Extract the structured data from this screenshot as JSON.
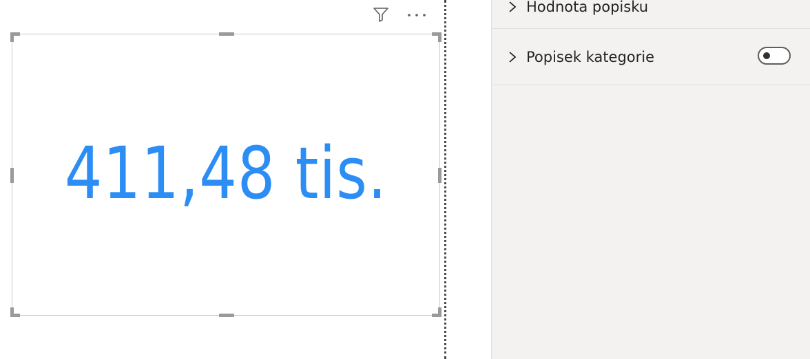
{
  "visual": {
    "card_value": "411,48 tis.",
    "value_color": "#2c8ef4"
  },
  "visual_header": {
    "filter_icon": "filter-icon",
    "more_icon": "more-options-icon"
  },
  "format_pane": {
    "sections": [
      {
        "label": "Hodnota popisku",
        "expanded": false,
        "icon": "chevron-right-icon"
      },
      {
        "label": "Popisek kategorie",
        "expanded": false,
        "icon": "chevron-right-icon",
        "toggle": "off"
      }
    ]
  }
}
